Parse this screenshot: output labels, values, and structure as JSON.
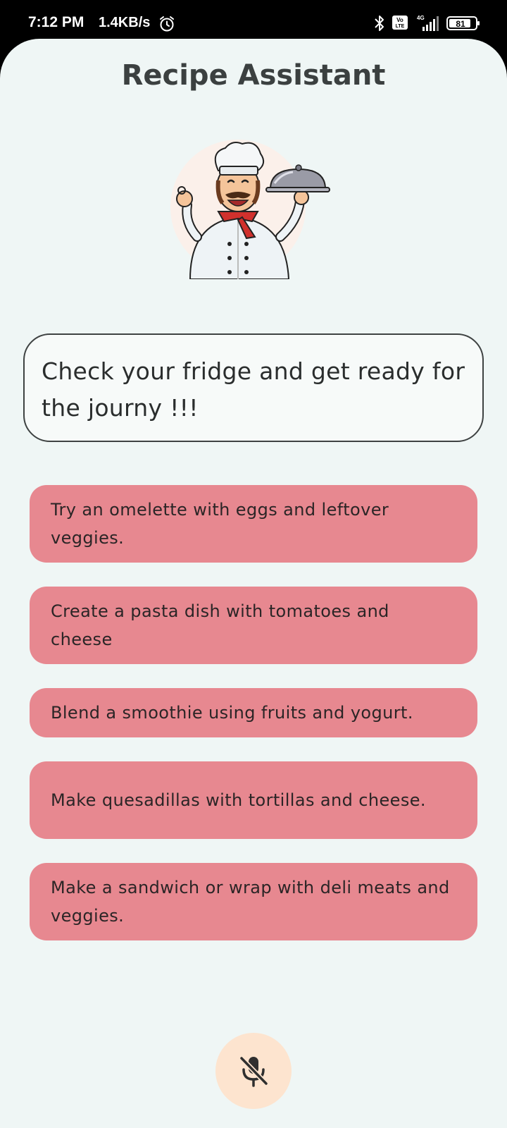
{
  "status_bar": {
    "time": "7:12 PM",
    "speed": "1.4KB/s",
    "network": "4G",
    "volte": "Vo LTE",
    "battery": "81"
  },
  "app": {
    "title": "Recipe Assistant"
  },
  "intro": {
    "text": "Check your fridge and get ready for the journy !!!"
  },
  "suggestions": [
    "Try an omelette with eggs and leftover veggies.",
    "Create a pasta dish with tomatoes and cheese",
    "Blend a smoothie using fruits and yogurt.",
    "Make quesadillas with tortillas and cheese.",
    "Make a sandwich or wrap with deli meats and veggies."
  ],
  "mic": {
    "icon": "mic-off-icon",
    "state": "muted"
  },
  "colors": {
    "background": "#eff6f5",
    "suggestion_bg": "#e78890",
    "mic_bg": "#fde4cf",
    "title": "#3b4040"
  }
}
